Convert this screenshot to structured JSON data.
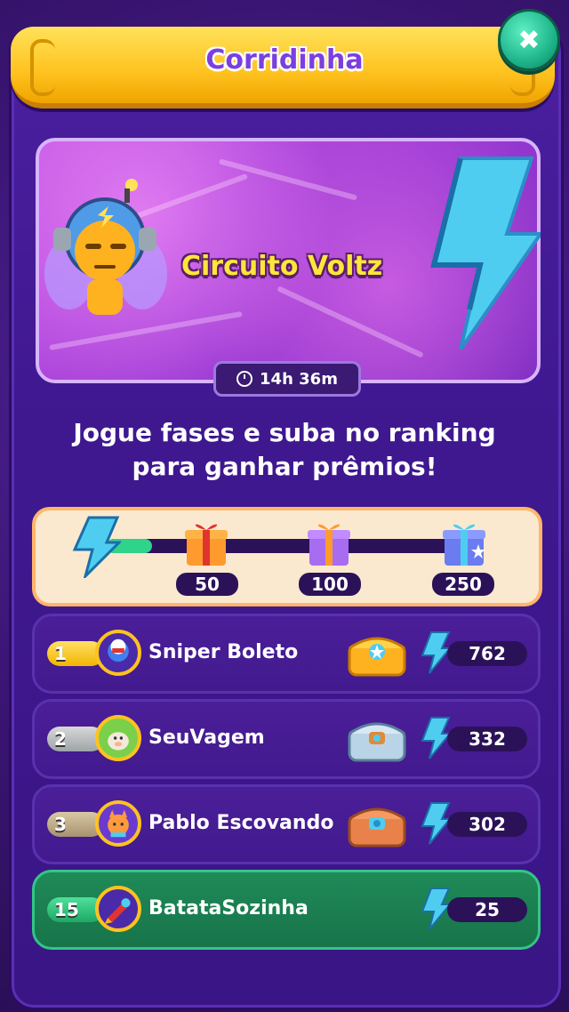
{
  "header": {
    "title": "Corridinha"
  },
  "event": {
    "name": "Circuito Voltz",
    "timer": "14h 36m"
  },
  "instruction": {
    "line1": "Jogue fases e suba no ranking",
    "line2": "para ganhar prêmios!"
  },
  "progress": {
    "fill_fraction": 0.13,
    "milestones": [
      "50",
      "100",
      "250"
    ]
  },
  "leaderboard": [
    {
      "rank": "1",
      "name": "Sniper Boleto",
      "score": "762",
      "chest": "gold-chest"
    },
    {
      "rank": "2",
      "name": "SeuVagem",
      "score": "332",
      "chest": "silver-chest"
    },
    {
      "rank": "3",
      "name": "Pablo Escovando",
      "score": "302",
      "chest": "bronze-chest"
    },
    {
      "rank": "15",
      "name": "BatataSozinha",
      "score": "25",
      "chest": ""
    }
  ],
  "colors": {
    "accent": "#ffc21f",
    "panel": "#4c1fa0",
    "highlight": "#1f8a58",
    "close": "#1fb58a"
  }
}
